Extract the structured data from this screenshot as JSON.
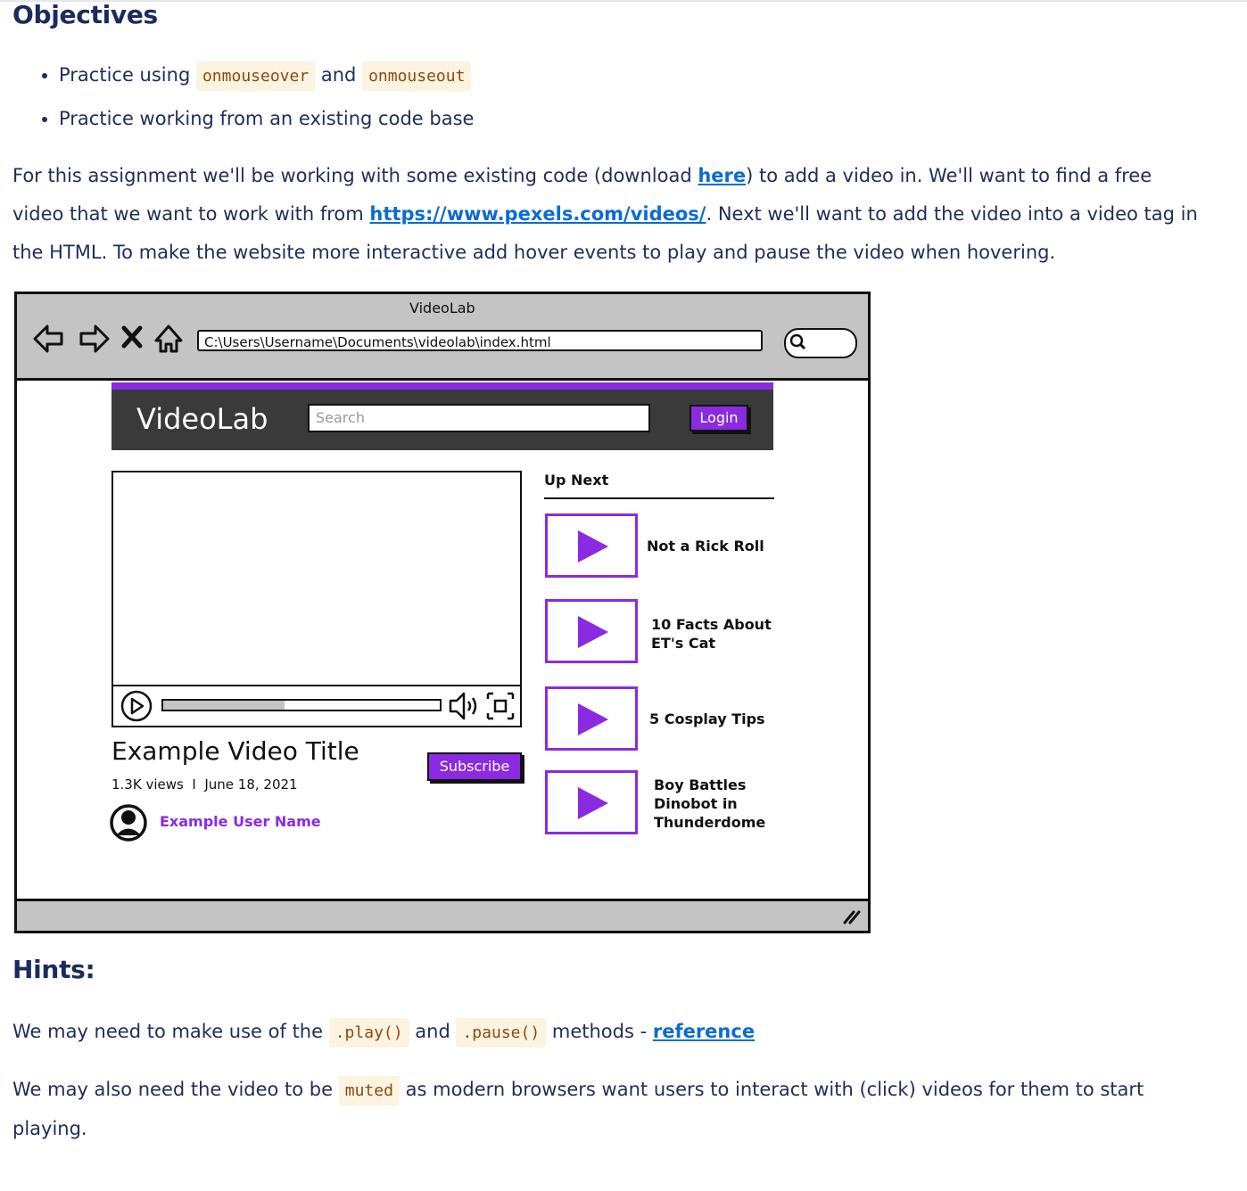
{
  "objectives": {
    "title": "Objectives",
    "items": [
      {
        "prefix": "Practice using",
        "code1": "onmouseover",
        "middle": "and",
        "code2": "onmouseout"
      },
      {
        "text": "Practice working from an existing code base"
      }
    ]
  },
  "intro": {
    "t1": "For this assignment we'll be working with some existing code (download ",
    "link_here": "here",
    "t2": ") to add a video in. We'll want to find a free video that we want to work with from ",
    "link_pexels": "https://www.pexels.com/videos/",
    "t3": ".  Next we'll want to add the video into a video tag in the HTML. To make the website more interactive add hover events to play and pause the video when hovering."
  },
  "wireframe": {
    "window_title": "VideoLab",
    "url": "C:\\Users\\Username\\Documents\\videolab\\index.html",
    "logo": "VideoLab",
    "search_placeholder": "Search",
    "login": "Login",
    "video_title": "Example Video Title",
    "views": "1.3K views",
    "sep": "I",
    "date": "June 18, 2021",
    "subscribe": "Subscribe",
    "user_name": "Example User Name",
    "progress": 0.44,
    "up_next": "Up Next",
    "videos": [
      {
        "lines": [
          "Not a Rick Roll"
        ]
      },
      {
        "lines": [
          "10 Facts About",
          "ET's Cat"
        ]
      },
      {
        "lines": [
          "5 Cosplay Tips"
        ]
      },
      {
        "lines": [
          "Boy Battles",
          "Dinobot in",
          "Thunderdome"
        ]
      }
    ]
  },
  "hints": {
    "title": "Hints:",
    "p1": {
      "t1": "We may need to make use of the",
      "code1": ".play()",
      "mid": "and",
      "code2": ".pause()",
      "t2": "methods -",
      "link": "reference"
    },
    "p2": {
      "t1": "We may also need the video to be",
      "code": "muted",
      "t2": "as modern browsers want users to interact with (click) videos for them to start playing."
    }
  },
  "colors": {
    "heading": "#1a2b5e",
    "link": "#0b6bd4",
    "accent": "#8a2be2",
    "code_bg": "#fdf3e1",
    "code_fg": "#8a4b0f"
  }
}
